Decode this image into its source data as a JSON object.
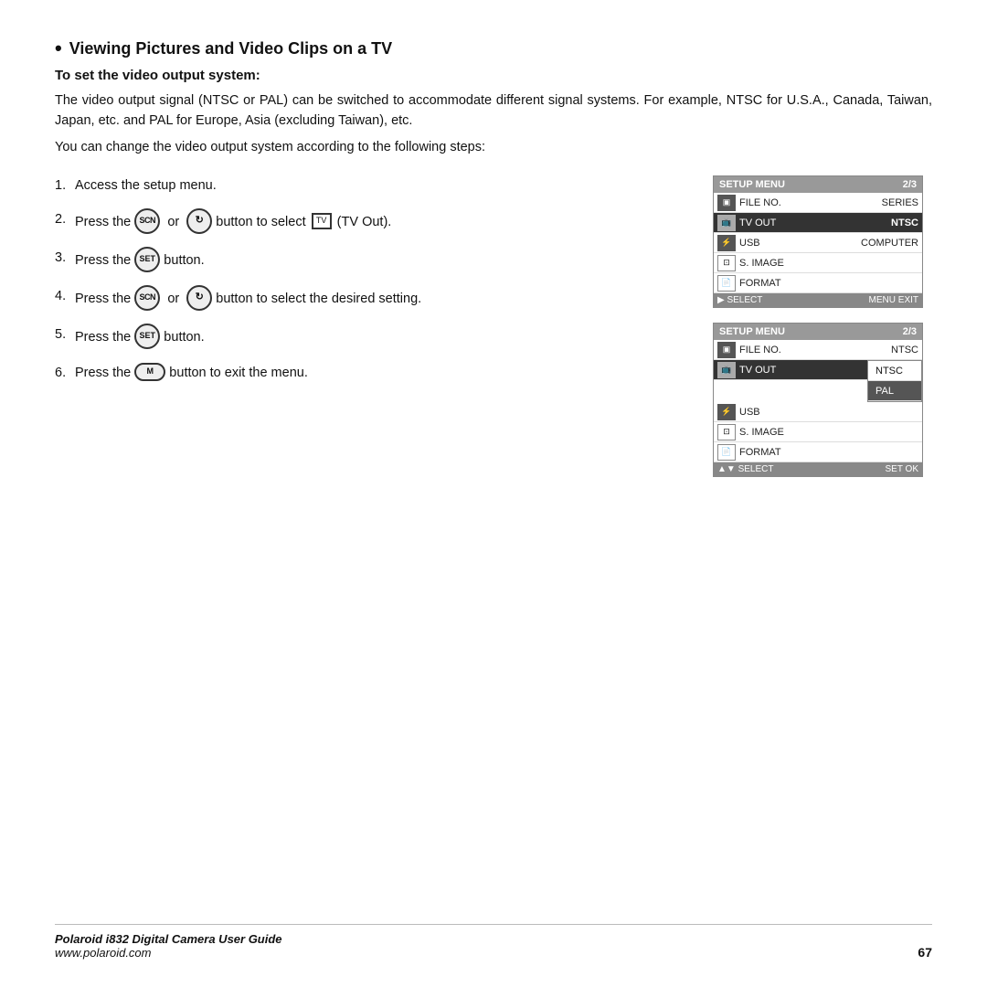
{
  "page": {
    "title": "Viewing Pictures and Video Clips on a TV",
    "subtitle": "To set the video output system:",
    "body1": "The video output signal (NTSC or PAL) can be switched to accommodate different signal systems. For example, NTSC for U.S.A., Canada, Taiwan, Japan, etc. and PAL for Europe, Asia (excluding Taiwan), etc.",
    "body2": "You can change the video output system according to the following steps:",
    "steps": [
      {
        "num": "1.",
        "text": "Access the setup menu."
      },
      {
        "num": "2.",
        "text_parts": [
          "Press the",
          "or",
          "button to select",
          "(TV Out)."
        ]
      },
      {
        "num": "3.",
        "text_parts": [
          "Press the",
          "button."
        ]
      },
      {
        "num": "4.",
        "text_parts": [
          "Press the",
          "or",
          "button to select the desired setting."
        ]
      },
      {
        "num": "5.",
        "text_parts": [
          "Press the",
          "button."
        ]
      },
      {
        "num": "6.",
        "text_parts": [
          "Press the",
          "button to exit the menu."
        ]
      }
    ],
    "menu1": {
      "header_label": "SETUP MENU",
      "header_page": "2/3",
      "rows": [
        {
          "icon": "📷",
          "label": "FILE NO.",
          "value": "SERIES",
          "selected": false
        },
        {
          "icon": "📺",
          "label": "TV OUT",
          "value": "NTSC",
          "selected": true
        },
        {
          "icon": "🔌",
          "label": "USB",
          "value": "COMPUTER",
          "selected": false
        },
        {
          "icon": "📷",
          "label": "S. IMAGE",
          "value": "",
          "selected": false
        },
        {
          "icon": "📄",
          "label": "FORMAT",
          "value": "",
          "selected": false
        }
      ],
      "footer_left": "▶ SELECT",
      "footer_right": "MENU EXIT"
    },
    "menu2": {
      "header_label": "SETUP MENU",
      "header_page": "2/3",
      "rows": [
        {
          "icon": "📷",
          "label": "FILE NO.",
          "value": "NTSC",
          "selected": false
        },
        {
          "icon": "📺",
          "label": "TV OUT",
          "value": "",
          "selected": true
        },
        {
          "icon": "🔌",
          "label": "USB",
          "value": "",
          "selected": false
        },
        {
          "icon": "📷",
          "label": "S. IMAGE",
          "value": "",
          "selected": false
        },
        {
          "icon": "📄",
          "label": "FORMAT",
          "value": "",
          "selected": false
        }
      ],
      "submenu": [
        {
          "label": "NTSC",
          "selected": false
        },
        {
          "label": "PAL",
          "selected": true
        }
      ],
      "footer_left": "▲▼ SELECT",
      "footer_right": "SET OK"
    },
    "footer": {
      "brand": "Polaroid i832 Digital Camera User Guide",
      "url": "www.polaroid.com",
      "page": "67"
    }
  }
}
